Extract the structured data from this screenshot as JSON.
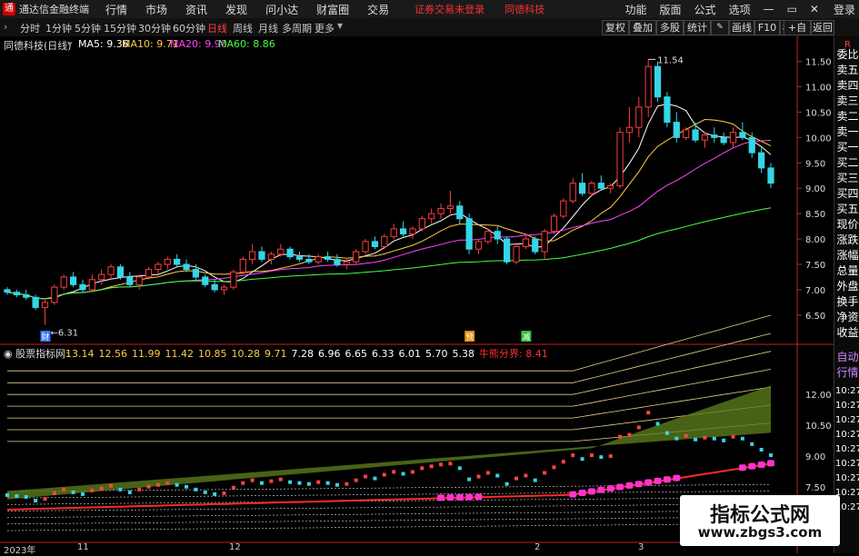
{
  "app": {
    "name": "通达信金融终端",
    "logo_text": "通"
  },
  "menu": [
    "行情",
    "市场",
    "资讯",
    "发现",
    "问小达",
    "财富圈",
    "交易"
  ],
  "notice": [
    "证券交易未登录",
    "同德科技"
  ],
  "right_menu": [
    "功能",
    "版面",
    "公式",
    "选项"
  ],
  "right_extra": "登录",
  "periods": [
    {
      "label": "分时",
      "active": false
    },
    {
      "label": "1分钟",
      "active": false
    },
    {
      "label": "5分钟",
      "active": false
    },
    {
      "label": "15分钟",
      "active": false
    },
    {
      "label": "30分钟",
      "active": false
    },
    {
      "label": "60分钟",
      "active": false
    },
    {
      "label": "日线",
      "active": true
    },
    {
      "label": "周线",
      "active": false
    },
    {
      "label": "月线",
      "active": false
    },
    {
      "label": "多周期",
      "active": false
    },
    {
      "label": "更多",
      "active": false
    }
  ],
  "toolbar_buttons": [
    "复权",
    "叠加",
    "多股",
    "统计",
    "画线",
    "F10",
    "标记",
    "+自选",
    "返回"
  ],
  "main_title": "同德科技(日线)",
  "ma_labels": [
    {
      "text": "MA5: 9.36",
      "color": "#ffffff"
    },
    {
      "text": "MA10: 9.71",
      "color": "#ffcc44"
    },
    {
      "text": "MA20: 9.90",
      "color": "#ff44ff"
    },
    {
      "text": "MA60: 8.86",
      "color": "#44ff44"
    }
  ],
  "price_axis": [
    "11.50",
    "11.00",
    "10.50",
    "10.00",
    "9.50",
    "9.00",
    "8.50",
    "8.00",
    "7.50",
    "7.00",
    "6.50"
  ],
  "high_label": "11.54",
  "low_label": "6.31",
  "markers": [
    {
      "text": "财"
    },
    {
      "text": "预"
    },
    {
      "text": "减"
    }
  ],
  "indicator_title": "股票指标网",
  "indicator_values": [
    "13.14",
    "12.56",
    "11.99",
    "11.42",
    "10.85",
    "10.28",
    "9.71",
    "7.28",
    "6.96",
    "6.65",
    "6.33",
    "6.01",
    "5.70",
    "5.38"
  ],
  "indicator_special": {
    "label": "牛熊分界",
    "value": "8.41"
  },
  "indicator_axis": [
    "12.00",
    "10.50",
    "9.00",
    "7.50"
  ],
  "sidebar": [
    "委比",
    "卖五",
    "卖四",
    "卖三",
    "卖二",
    "卖一",
    "买一",
    "买二",
    "买三",
    "买四",
    "买五",
    "现价",
    "涨跌",
    "涨幅",
    "总量",
    "外盘",
    "换手",
    "净资",
    "收益"
  ],
  "sidebar_top": "R",
  "sidebar_bottom": [
    "自动",
    "行情"
  ],
  "sidebar_times": [
    "10:27",
    "10:27",
    "10:27",
    "10:27",
    "10:27",
    "10:27",
    "10:27",
    "10:27",
    "10:27"
  ],
  "x_labels": [
    "2023年",
    "11",
    "12",
    "2",
    "3"
  ],
  "watermark": {
    "title": "指标公式网",
    "url": "www.zbgs3.com"
  },
  "colors": {
    "up": "#ff3c3c",
    "down": "#35d5e8",
    "ma5": "#ffffff",
    "ma10": "#ffcc44",
    "ma20": "#ff44ff",
    "ma60": "#44ff44"
  },
  "chart_data": {
    "type": "candlestick",
    "ylim": [
      6.3,
      11.6
    ],
    "candles": [
      [
        7.0,
        7.05,
        6.9,
        6.95
      ],
      [
        6.95,
        7.0,
        6.85,
        6.9
      ],
      [
        6.9,
        7.0,
        6.8,
        6.85
      ],
      [
        6.85,
        6.9,
        6.6,
        6.65
      ],
      [
        6.65,
        6.8,
        6.31,
        6.75
      ],
      [
        6.75,
        7.1,
        6.7,
        7.05
      ],
      [
        7.05,
        7.3,
        7.0,
        7.25
      ],
      [
        7.25,
        7.35,
        7.05,
        7.1
      ],
      [
        7.1,
        7.2,
        6.95,
        7.0
      ],
      [
        7.0,
        7.3,
        6.95,
        7.2
      ],
      [
        7.2,
        7.4,
        7.1,
        7.3
      ],
      [
        7.3,
        7.5,
        7.2,
        7.45
      ],
      [
        7.45,
        7.5,
        7.2,
        7.25
      ],
      [
        7.25,
        7.35,
        7.05,
        7.1
      ],
      [
        7.1,
        7.3,
        7.0,
        7.25
      ],
      [
        7.25,
        7.45,
        7.2,
        7.4
      ],
      [
        7.4,
        7.55,
        7.3,
        7.5
      ],
      [
        7.5,
        7.65,
        7.4,
        7.6
      ],
      [
        7.6,
        7.7,
        7.45,
        7.5
      ],
      [
        7.5,
        7.6,
        7.35,
        7.4
      ],
      [
        7.4,
        7.5,
        7.2,
        7.25
      ],
      [
        7.25,
        7.3,
        7.05,
        7.1
      ],
      [
        7.1,
        7.2,
        6.95,
        7.0
      ],
      [
        7.0,
        7.1,
        6.9,
        7.05
      ],
      [
        7.05,
        7.4,
        7.0,
        7.35
      ],
      [
        7.35,
        7.65,
        7.3,
        7.6
      ],
      [
        7.6,
        7.9,
        7.5,
        7.75
      ],
      [
        7.75,
        7.85,
        7.55,
        7.6
      ],
      [
        7.6,
        7.75,
        7.5,
        7.7
      ],
      [
        7.7,
        7.9,
        7.65,
        7.8
      ],
      [
        7.8,
        7.85,
        7.6,
        7.65
      ],
      [
        7.65,
        7.75,
        7.55,
        7.6
      ],
      [
        7.6,
        7.7,
        7.5,
        7.55
      ],
      [
        7.55,
        7.7,
        7.5,
        7.65
      ],
      [
        7.65,
        7.75,
        7.55,
        7.6
      ],
      [
        7.6,
        7.7,
        7.45,
        7.5
      ],
      [
        7.5,
        7.6,
        7.4,
        7.55
      ],
      [
        7.55,
        7.8,
        7.5,
        7.75
      ],
      [
        7.75,
        8.0,
        7.7,
        7.95
      ],
      [
        7.95,
        8.05,
        7.8,
        7.85
      ],
      [
        7.85,
        8.1,
        7.8,
        8.05
      ],
      [
        8.05,
        8.3,
        8.0,
        8.2
      ],
      [
        8.2,
        8.35,
        8.05,
        8.1
      ],
      [
        8.1,
        8.25,
        8.0,
        8.2
      ],
      [
        8.2,
        8.45,
        8.15,
        8.4
      ],
      [
        8.4,
        8.6,
        8.3,
        8.5
      ],
      [
        8.5,
        8.7,
        8.4,
        8.6
      ],
      [
        8.6,
        8.95,
        8.5,
        8.65
      ],
      [
        8.65,
        8.75,
        8.3,
        8.4
      ],
      [
        8.4,
        8.5,
        7.7,
        7.8
      ],
      [
        7.8,
        8.0,
        7.7,
        7.95
      ],
      [
        7.95,
        8.2,
        7.9,
        8.15
      ],
      [
        8.15,
        8.25,
        7.9,
        8.0
      ],
      [
        8.0,
        8.05,
        7.5,
        7.55
      ],
      [
        7.55,
        7.9,
        7.5,
        7.85
      ],
      [
        7.85,
        8.1,
        7.8,
        8.0
      ],
      [
        8.0,
        8.05,
        7.7,
        7.75
      ],
      [
        7.75,
        8.2,
        7.6,
        8.15
      ],
      [
        8.15,
        8.5,
        8.1,
        8.45
      ],
      [
        8.45,
        8.8,
        8.4,
        8.75
      ],
      [
        8.75,
        9.2,
        8.7,
        9.1
      ],
      [
        9.1,
        9.3,
        8.85,
        8.9
      ],
      [
        8.9,
        9.15,
        8.85,
        9.1
      ],
      [
        9.1,
        9.25,
        8.95,
        9.0
      ],
      [
        9.0,
        9.1,
        8.9,
        9.05
      ],
      [
        9.05,
        10.2,
        9.0,
        10.1
      ],
      [
        10.1,
        10.6,
        9.9,
        10.2
      ],
      [
        10.2,
        10.8,
        10.0,
        10.6
      ],
      [
        10.6,
        11.54,
        10.4,
        11.4
      ],
      [
        11.4,
        11.5,
        10.7,
        10.8
      ],
      [
        10.8,
        10.9,
        10.2,
        10.3
      ],
      [
        10.3,
        10.5,
        9.9,
        10.0
      ],
      [
        10.0,
        10.2,
        9.95,
        10.15
      ],
      [
        10.15,
        10.3,
        9.9,
        9.95
      ],
      [
        9.95,
        10.1,
        9.8,
        10.05
      ],
      [
        10.05,
        10.2,
        9.9,
        10.0
      ],
      [
        10.0,
        10.1,
        9.85,
        9.9
      ],
      [
        9.9,
        10.2,
        9.8,
        10.1
      ],
      [
        10.1,
        10.3,
        9.95,
        10.0
      ],
      [
        10.0,
        10.1,
        9.6,
        9.7
      ],
      [
        9.7,
        9.8,
        9.3,
        9.4
      ],
      [
        9.4,
        9.5,
        9.0,
        9.1
      ]
    ]
  }
}
